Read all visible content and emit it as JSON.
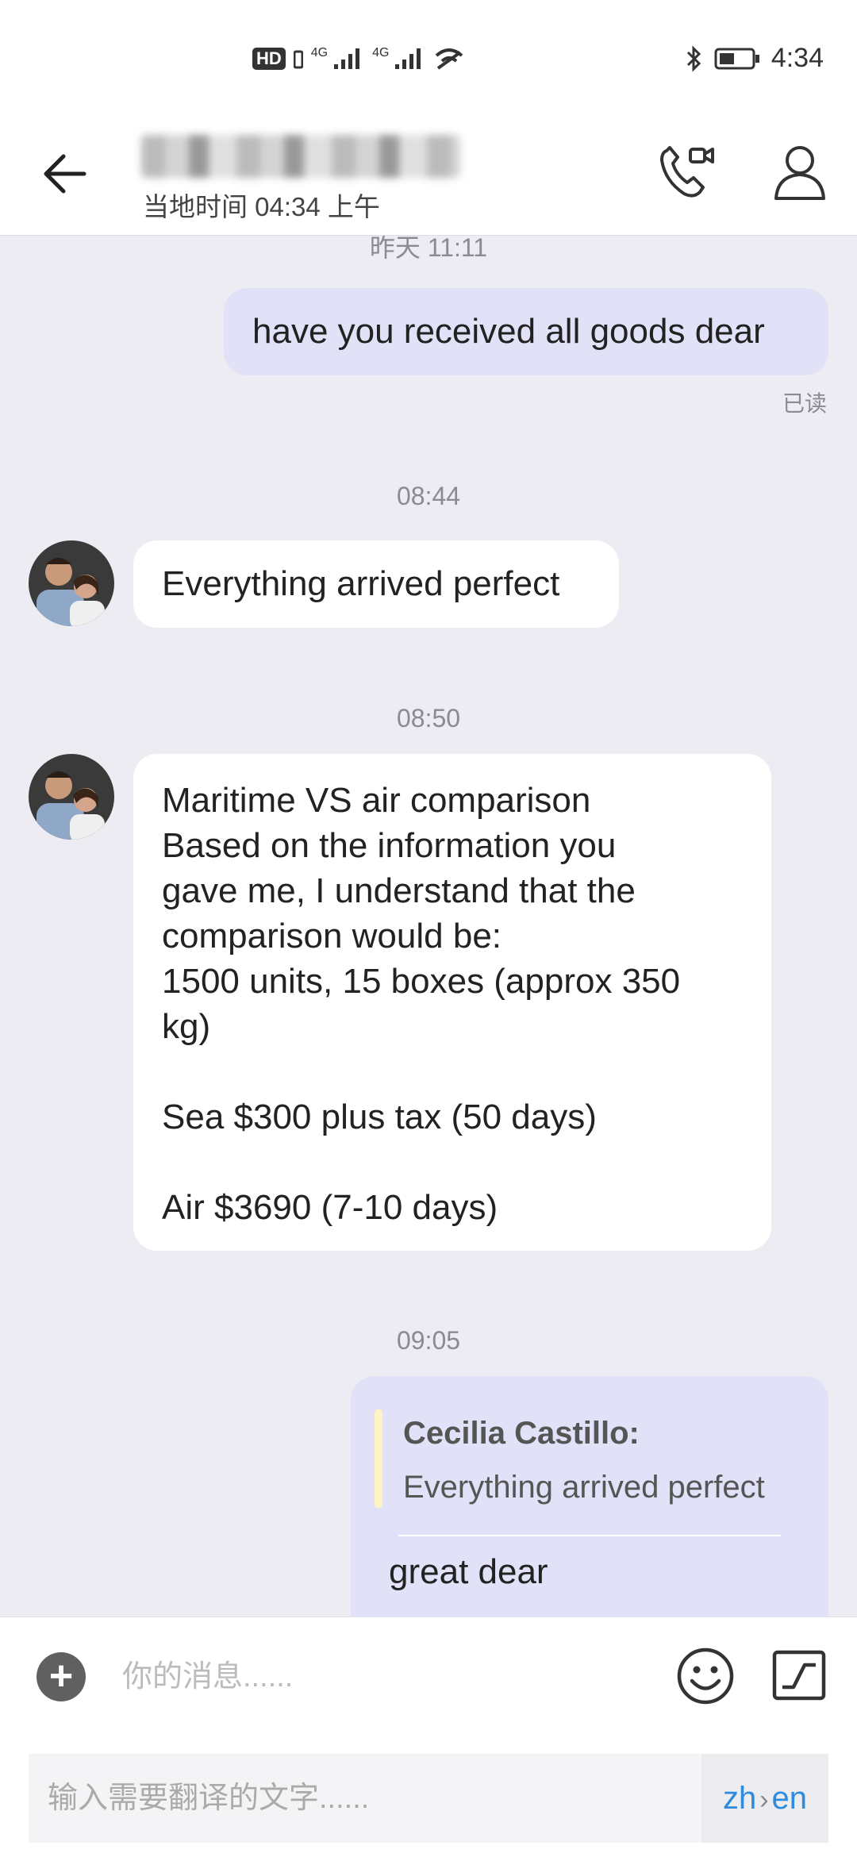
{
  "status_bar": {
    "hd_label": "HD",
    "signal_1_label": "4G",
    "signal_2_label": "4G",
    "time": "4:34"
  },
  "header": {
    "local_time": "当地时间 04:34 上午"
  },
  "messages": {
    "yesterday_timestamp": "昨天 11:11",
    "sent_1": "have you received all goods dear",
    "read_status": "已读",
    "ts_1": "08:44",
    "received_1": "Everything arrived perfect",
    "ts_2": "08:50",
    "received_2_lines": [
      "Maritime VS air comparison",
      "Based on the information you",
      "gave me, I understand that the",
      "comparison would be:",
      "1500 units, 15 boxes (approx 350",
      "kg)",
      "",
      "Sea $300 plus tax (50 days)",
      "",
      "Air $3690 (7-10 days)"
    ],
    "ts_3": "09:05",
    "reply": {
      "quote_author": "Cecilia Castillo:",
      "quote_text": "Everything arrived perfect",
      "text": "great dear"
    }
  },
  "input_bar": {
    "placeholder": "你的消息......"
  },
  "translate_bar": {
    "placeholder": "输入需要翻译的文字......",
    "source_lang": "zh",
    "target_lang": "en"
  },
  "colors": {
    "background": "#ececf2",
    "outgoing_bubble": "#e1e1f8",
    "incoming_bubble": "#ffffff",
    "accent_blue": "#2d8be0"
  }
}
